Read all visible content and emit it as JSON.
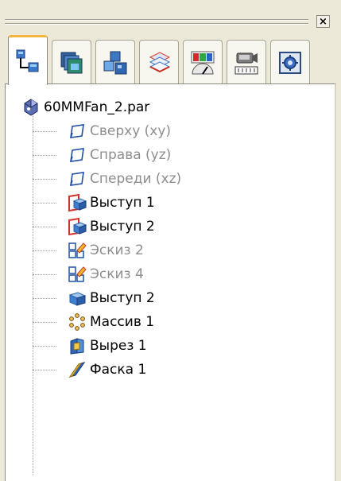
{
  "window": {
    "close_label": "×"
  },
  "tabs": [
    {
      "icon": "feature-tree-icon",
      "active": true
    },
    {
      "icon": "layers-icon",
      "active": false
    },
    {
      "icon": "parts-library-icon",
      "active": false
    },
    {
      "icon": "family-of-parts-icon",
      "active": false
    },
    {
      "icon": "feature-color-icon",
      "active": false
    },
    {
      "icon": "camera-animation-icon",
      "active": false
    },
    {
      "icon": "settings-icon",
      "active": false
    }
  ],
  "tree": {
    "root": {
      "label": "60MMFan_2.par",
      "icon": "part-icon"
    },
    "items": [
      {
        "label": "Сверху (xy)",
        "icon": "reference-plane-icon",
        "dim": true
      },
      {
        "label": "Справа (yz)",
        "icon": "reference-plane-icon",
        "dim": true
      },
      {
        "label": "Спереди (xz)",
        "icon": "reference-plane-icon",
        "dim": true
      },
      {
        "label": "Выступ 1",
        "icon": "protrusion-icon",
        "dim": false
      },
      {
        "label": "Выступ 2",
        "icon": "protrusion-icon",
        "dim": false
      },
      {
        "label": "Эскиз 2",
        "icon": "sketch-icon",
        "dim": true
      },
      {
        "label": "Эскиз 4",
        "icon": "sketch-icon",
        "dim": true
      },
      {
        "label": "Выступ 2",
        "icon": "extrude-icon",
        "dim": false
      },
      {
        "label": "Массив 1",
        "icon": "pattern-icon",
        "dim": false
      },
      {
        "label": "Вырез 1",
        "icon": "cutout-icon",
        "dim": false
      },
      {
        "label": "Фаска 1",
        "icon": "chamfer-icon",
        "dim": false
      }
    ]
  }
}
